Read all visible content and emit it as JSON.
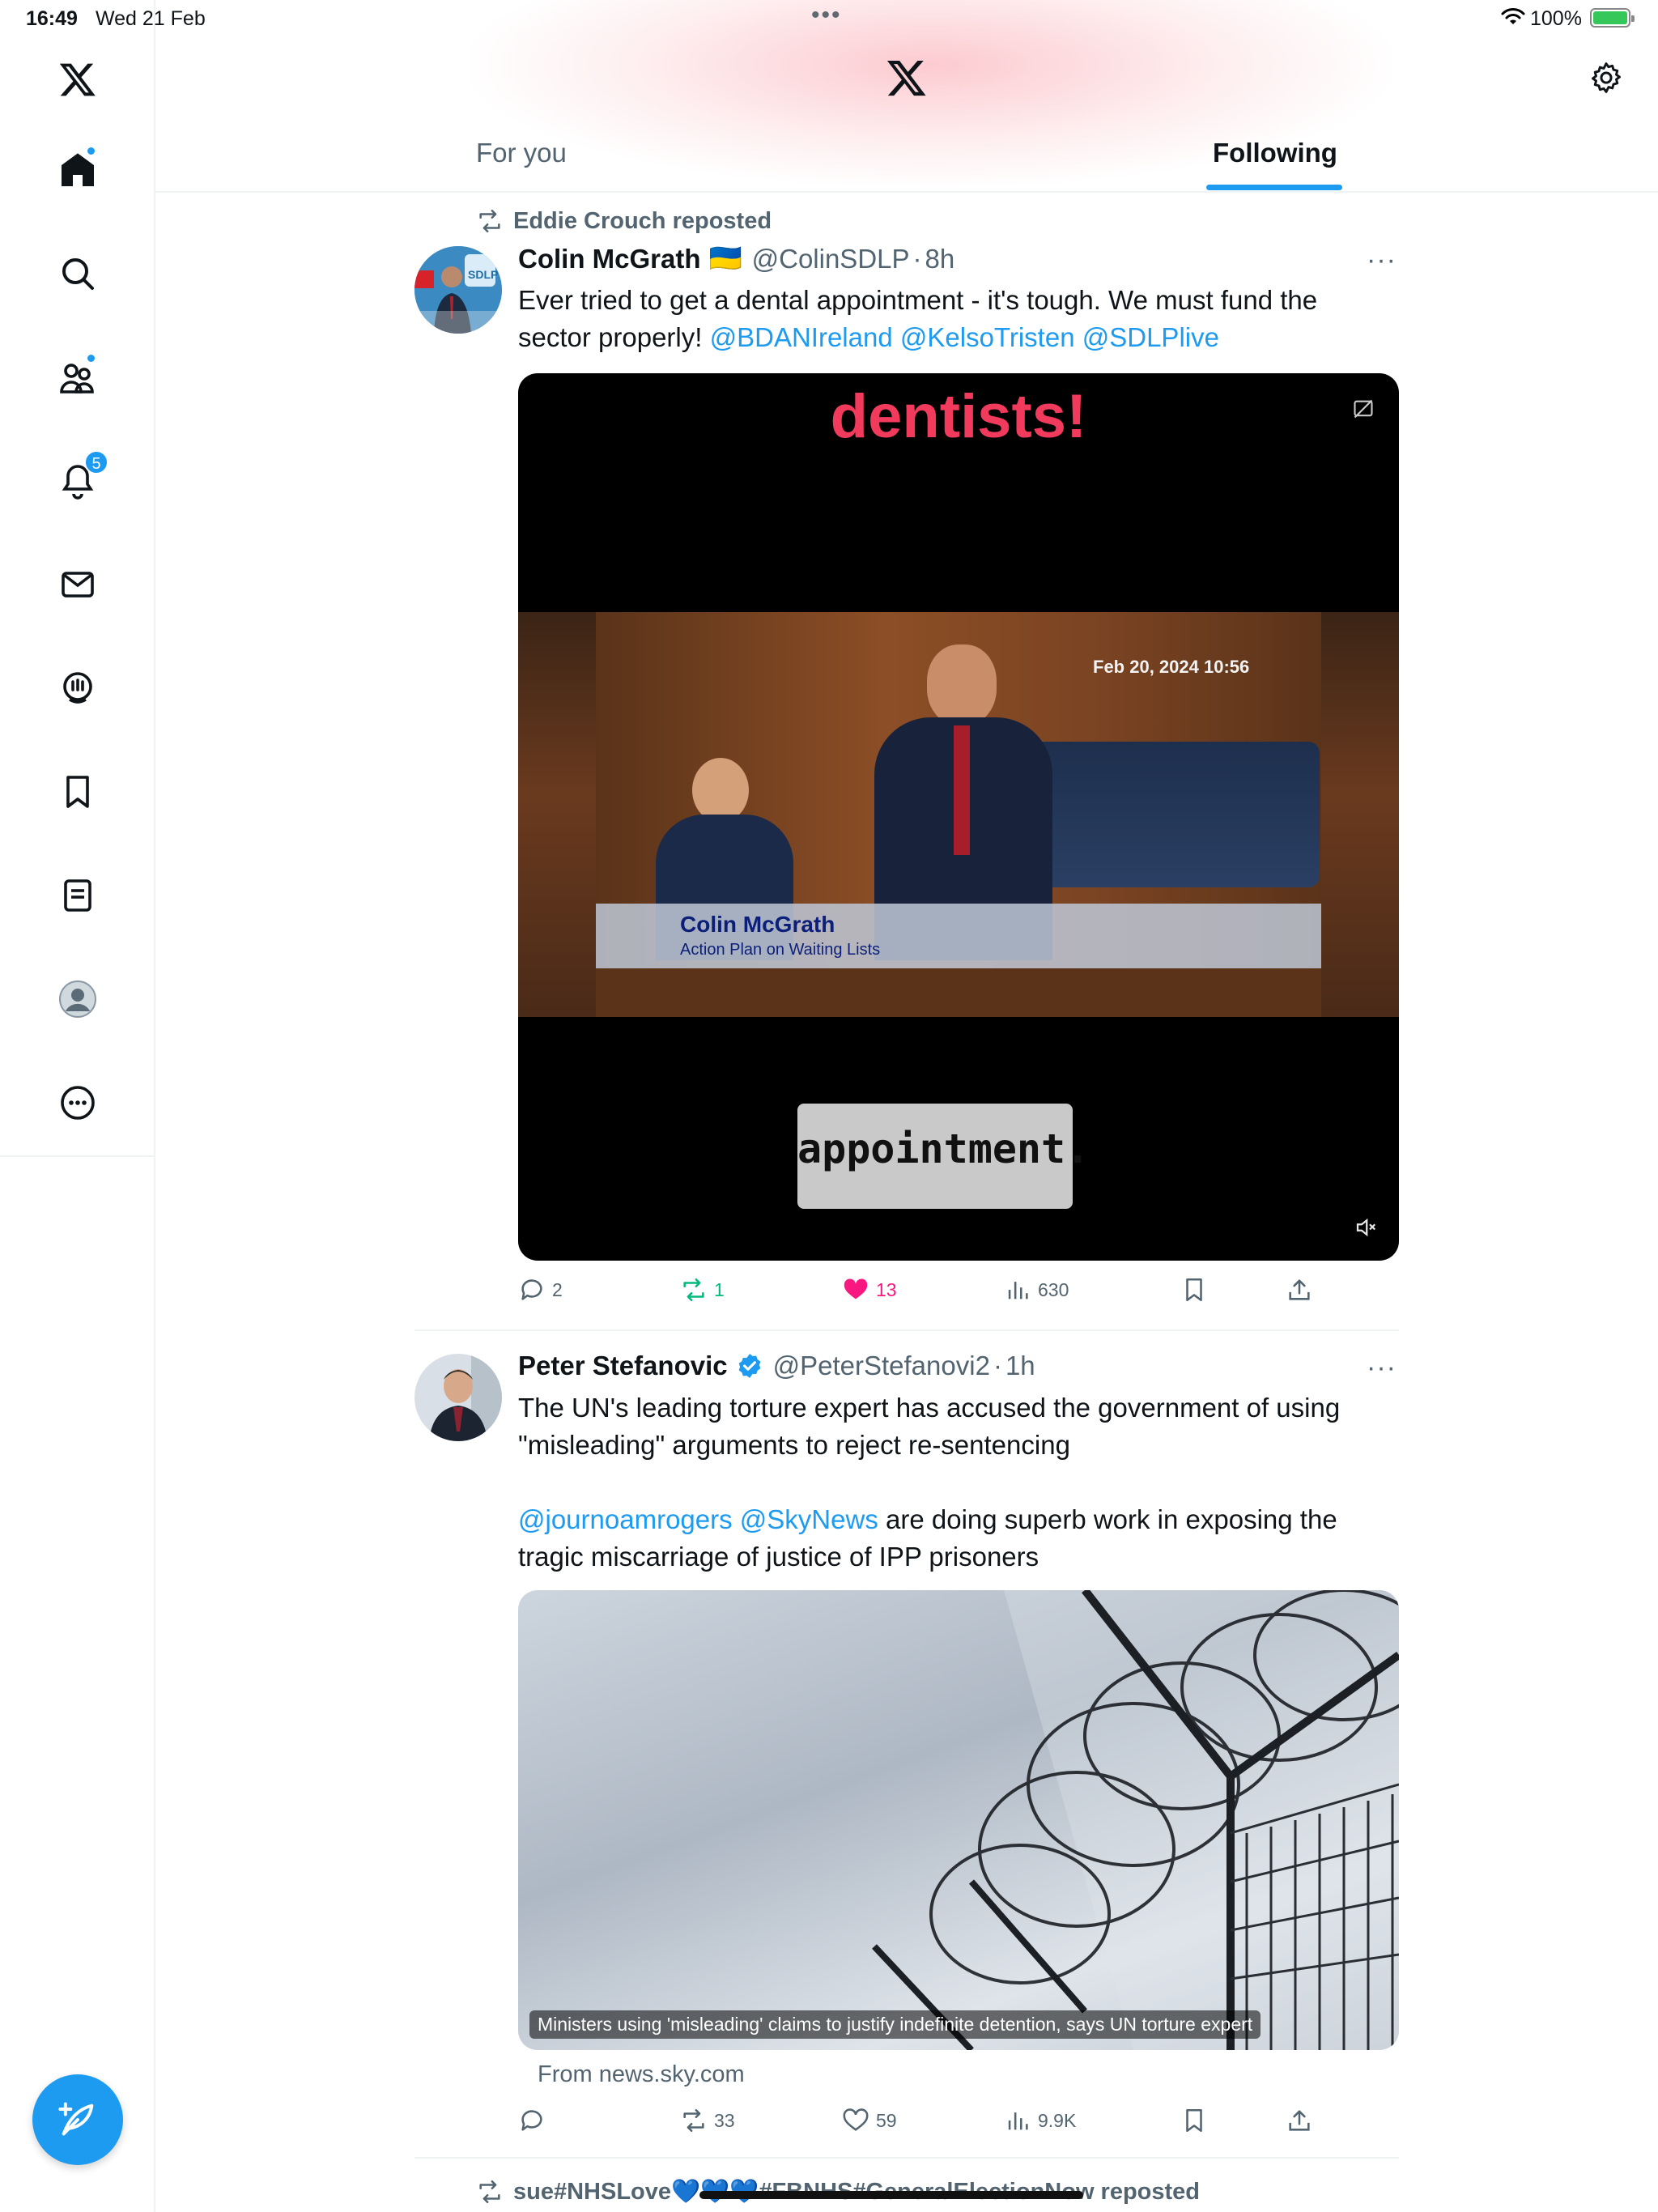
{
  "status_bar": {
    "time": "16:49",
    "date": "Wed 21 Feb",
    "battery": "100%"
  },
  "sidebar": {
    "items": [
      {
        "name": "home",
        "icon": "home-icon"
      },
      {
        "name": "explore",
        "icon": "search-icon"
      },
      {
        "name": "communities",
        "icon": "communities-icon"
      },
      {
        "name": "notifications",
        "icon": "bell-icon",
        "badge": "5"
      },
      {
        "name": "messages",
        "icon": "envelope-icon"
      },
      {
        "name": "spaces",
        "icon": "spaces-icon"
      },
      {
        "name": "bookmarks",
        "icon": "bookmark-icon"
      },
      {
        "name": "lists",
        "icon": "list-icon"
      },
      {
        "name": "profile",
        "icon": "avatar-icon"
      },
      {
        "name": "more",
        "icon": "more-circle-icon"
      }
    ]
  },
  "header": {
    "tabs": [
      {
        "label": "For you",
        "active": false
      },
      {
        "label": "Following",
        "active": true
      }
    ]
  },
  "tweets": [
    {
      "repost_by": "Eddie Crouch reposted",
      "name": "Colin McGrath",
      "flag": "🇺🇦",
      "handle": "@ColinSDLP",
      "time": "8h",
      "text_lines": [
        "Ever tried to get a dental appointment - it's tough. We must fund the",
        "sector properly!"
      ],
      "mentions": [
        "@BDANIreland",
        "@KelsoTristen",
        "@SDLPlive"
      ],
      "video": {
        "top_caption": "dentists!",
        "timestamp": "Feb 20, 2024 10:56",
        "lower_third_name": "Colin McGrath",
        "lower_third_sub": "Action Plan on Waiting Lists",
        "bottom_caption": "appointment."
      },
      "stats": {
        "replies": "2",
        "reposts": "1",
        "likes": "13",
        "views": "630"
      }
    },
    {
      "name": "Peter Stefanovic",
      "verified": true,
      "handle": "@PeterStefanovi2",
      "time": "1h",
      "text_line1": "The UN's leading torture expert has accused the government of using",
      "text_line2": "\"misleading\" arguments to reject re-sentencing",
      "mentions": [
        "@journoamrogers",
        "@SkyNews"
      ],
      "text_after_mentions": " are doing superb work in exposing the",
      "text_line4": "tragic miscarriage of justice of IPP prisoners",
      "card": {
        "caption": "Ministers using 'misleading' claims to justify indefinite detention, says UN torture expert",
        "source": "From news.sky.com"
      },
      "stats": {
        "replies": "",
        "reposts": "33",
        "likes": "59",
        "views": "9.9K"
      }
    },
    {
      "repost_by": "sue#NHSLove💙💙💙#FBNHS#GeneralElectionNow reposted"
    }
  ],
  "colors": {
    "accent": "#1d9bf0",
    "like": "#f91880",
    "repost": "#00ba7c",
    "secondary_text": "#536471"
  }
}
